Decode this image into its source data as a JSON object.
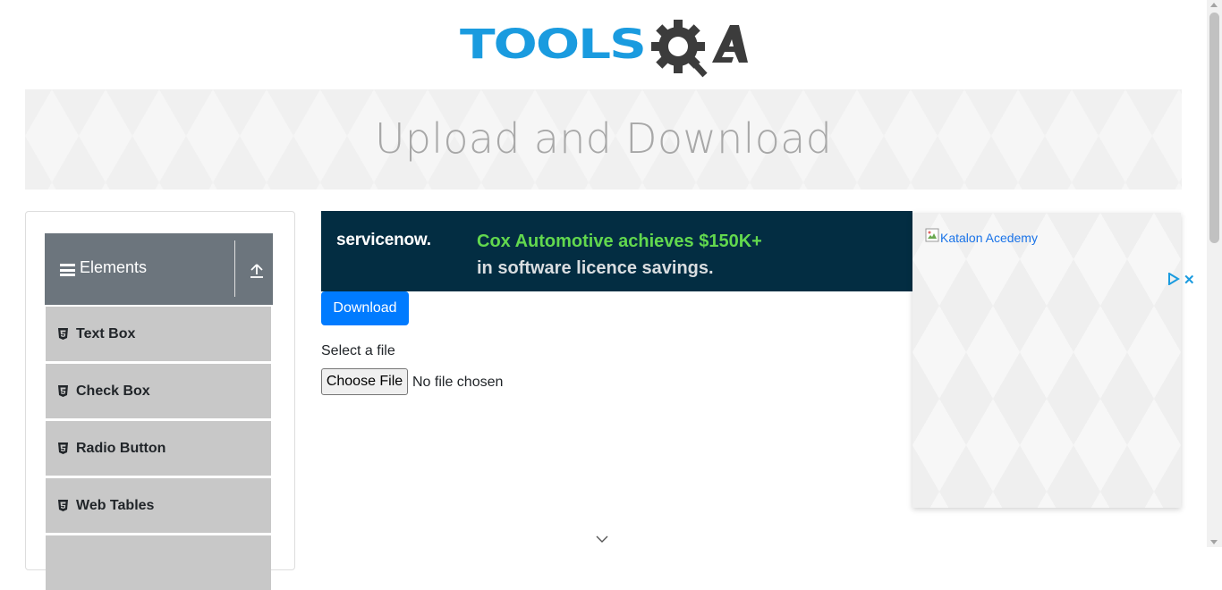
{
  "header": {
    "logo_text_part1": "TOOLS",
    "logo_text_part2": "QA",
    "logo_blue": "#1a9bdf",
    "logo_dark": "#3c3c3c"
  },
  "banner": {
    "title": "Upload and Download"
  },
  "sidebar": {
    "group": {
      "title": "Elements",
      "icon": "hamburger-icon",
      "toggle_icon": "upload-arrow-icon"
    },
    "items": [
      {
        "label": "Text Box",
        "icon": "html5-icon"
      },
      {
        "label": "Check Box",
        "icon": "html5-icon"
      },
      {
        "label": "Radio Button",
        "icon": "html5-icon"
      },
      {
        "label": "Web Tables",
        "icon": "html5-icon"
      }
    ]
  },
  "ad_strip": {
    "brand": "servicenow.",
    "headline": "Cox Automotive achieves $150K+",
    "subline": "in software licence savings.",
    "bg_color": "#032d42",
    "accent_color": "#62d84e"
  },
  "main": {
    "download_label": "Download",
    "select_label": "Select a file",
    "choose_file_label": "Choose File",
    "no_file_text": "No file chosen"
  },
  "right_ad": {
    "alt_text": "Katalon Acedemy",
    "close_symbol": "✕"
  },
  "colors": {
    "primary": "#007bff",
    "header_gray": "#6c757d",
    "menu_gray": "#c8c8c8"
  }
}
